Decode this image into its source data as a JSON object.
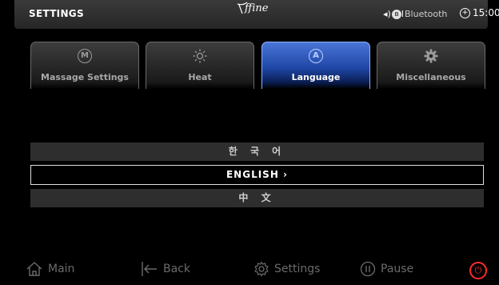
{
  "topbar": {
    "title": "SETTINGS",
    "brand": "ffine",
    "bluetooth_label": "Bluetooth",
    "clock": "15:00"
  },
  "tabs": [
    {
      "label": "Massage Settings",
      "icon": "massage-m-icon",
      "active": false
    },
    {
      "label": "Heat",
      "icon": "sun-icon",
      "active": false
    },
    {
      "label": "Language",
      "icon": "language-a-icon",
      "active": true
    },
    {
      "label": "Miscellaneous",
      "icon": "gear-icon",
      "active": false
    }
  ],
  "languages": [
    {
      "label": "한 국 어",
      "selected": false
    },
    {
      "label": "ENGLISH ›",
      "selected": true
    },
    {
      "label": "中 文",
      "selected": false
    }
  ],
  "bottombar": {
    "main": "Main",
    "back": "Back",
    "settings": "Settings",
    "pause": "Pause"
  },
  "colors": {
    "active_tab": "#2a55c0",
    "power": "#ff2a2a"
  }
}
